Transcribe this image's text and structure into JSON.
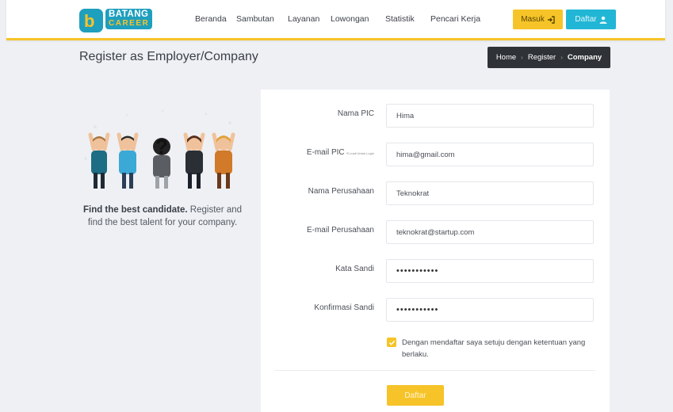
{
  "brand": {
    "line1": "BATANG",
    "line2": "CAREER",
    "mark": "b"
  },
  "nav": {
    "items": [
      "Beranda",
      "Sambutan",
      "Layanan",
      "Lowongan",
      "Statistik",
      "Pencari Kerja"
    ],
    "login_label": "Masuk",
    "login_icon": "sign-in-icon",
    "register_label": "Daftar",
    "register_icon": "user-icon"
  },
  "page": {
    "title": "Register as Employer/Company"
  },
  "breadcrumb": {
    "items": [
      "Home",
      "Register",
      "Company"
    ],
    "separator": "›"
  },
  "promo": {
    "bold": "Find the best candidate.",
    "text": " Register and find the best talent for your company."
  },
  "form": {
    "fields": [
      {
        "label": "Nama PIC",
        "note": "",
        "value": "Hima"
      },
      {
        "label": "E-mail PIC",
        "note": "*E-mail Untuk Login",
        "value": "hima@gmail.com"
      },
      {
        "label": "Nama Perusahaan",
        "note": "",
        "value": "Teknokrat"
      },
      {
        "label": "E-mail Perusahaan",
        "note": "",
        "value": "teknokrat@startup.com"
      },
      {
        "label": "Kata Sandi",
        "note": "",
        "value": "•••••••••••"
      },
      {
        "label": "Konfirmasi Sandi",
        "note": "",
        "value": "•••••••••••"
      }
    ],
    "agreement": "Dengan mendaftar saya setuju dengan ketentuan yang berlaku.",
    "agreement_checked": true,
    "submit_label": "Daftar"
  },
  "colors": {
    "accent": "#f6c428",
    "info": "#22b6d6",
    "dark": "#2f3236",
    "background": "#eef0f4"
  }
}
